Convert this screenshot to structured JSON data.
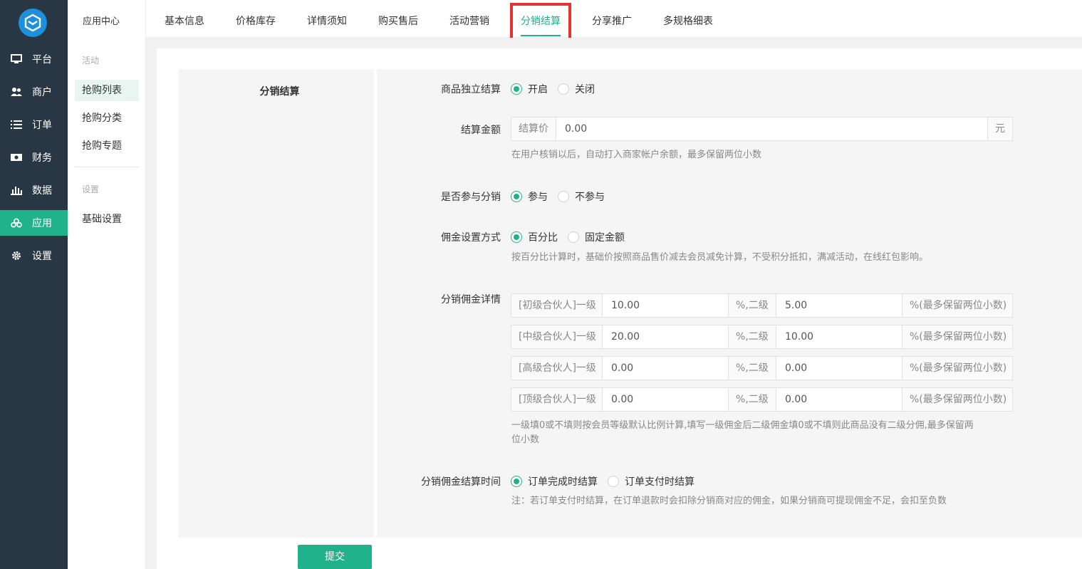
{
  "sidebar": {
    "items": [
      {
        "label": "平台",
        "icon": "monitor-icon"
      },
      {
        "label": "商户",
        "icon": "users-icon"
      },
      {
        "label": "订单",
        "icon": "list-icon"
      },
      {
        "label": "财务",
        "icon": "money-icon"
      },
      {
        "label": "数据",
        "icon": "bar-chart-icon"
      },
      {
        "label": "应用",
        "icon": "apps-icon",
        "active": true
      },
      {
        "label": "设置",
        "icon": "gear-icon"
      }
    ]
  },
  "subnav": {
    "app_title": "应用中心",
    "group1_label": "活动",
    "items_group1": [
      "抢购列表",
      "抢购分类",
      "抢购专题"
    ],
    "group2_label": "设置",
    "items_group2": [
      "基础设置"
    ]
  },
  "tabs": [
    "基本信息",
    "价格库存",
    "详情须知",
    "购买售后",
    "活动营销",
    "分销结算",
    "分享推广",
    "多规格细表"
  ],
  "active_tab": "分销结算",
  "section_title": "分销结算",
  "form": {
    "independent_label": "商品独立结算",
    "independent_options": [
      "开启",
      "关闭"
    ],
    "amount_label": "结算金额",
    "amount_prefix": "结算价",
    "amount_value": "0.00",
    "amount_suffix": "元",
    "amount_help": "在用户核销以后，自动打入商家帐户余额，最多保留两位小数",
    "join_label": "是否参与分销",
    "join_options": [
      "参与",
      "不参与"
    ],
    "commission_mode_label": "佣金设置方式",
    "commission_mode_options": [
      "百分比",
      "固定金额"
    ],
    "commission_mode_help": "按百分比计算时，基础价按照商品售价减去会员减免计算，不受积分抵扣，满减活动，在线红包影响。",
    "detail_label": "分销佣金详情",
    "detail_rows": [
      {
        "level1_label": "[初级合伙人]一级",
        "level1": "10.00",
        "mid_label": "%,二级",
        "level2": "5.00",
        "suffix": "%(最多保留两位小数)"
      },
      {
        "level1_label": "[中级合伙人]一级",
        "level1": "20.00",
        "mid_label": "%,二级",
        "level2": "10.00",
        "suffix": "%(最多保留两位小数)"
      },
      {
        "level1_label": "[高级合伙人]一级",
        "level1": "0.00",
        "mid_label": "%,二级",
        "level2": "0.00",
        "suffix": "%(最多保留两位小数)"
      },
      {
        "level1_label": "[顶级合伙人]一级",
        "level1": "0.00",
        "mid_label": "%,二级",
        "level2": "0.00",
        "suffix": "%(最多保留两位小数)"
      }
    ],
    "detail_help_line1": "一级填0或不填则按会员等级默认比例计算,填写一级佣金后二级佣金填0或不填则此商品没有二级分佣,最多保留两",
    "detail_help_line2": "位小数",
    "settle_time_label": "分销佣金结算时间",
    "settle_time_options": [
      "订单完成时结算",
      "订单支付时结算"
    ],
    "settle_time_help": "注：若订单支付时结算，在订单退款时会扣除分销商对应的佣金，如果分销商可提现佣金不足，会扣至负数"
  },
  "submit_label": "提交",
  "colors": {
    "accent": "#20b38b",
    "sidebar": "#293744",
    "highlight": "#e53333",
    "logo": "#1e8fdc"
  }
}
